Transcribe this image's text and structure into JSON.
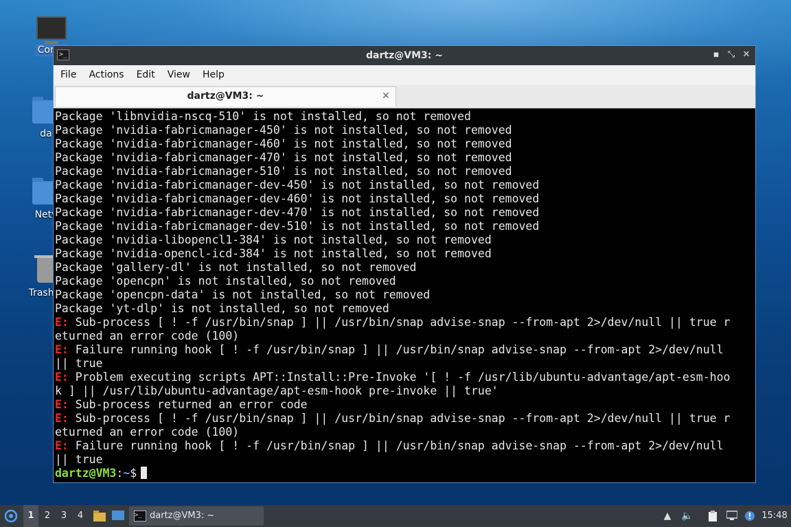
{
  "desktop": {
    "icons": [
      {
        "label": "Comp"
      },
      {
        "label": "da"
      },
      {
        "label": "Netv"
      },
      {
        "label": "Trash (l"
      }
    ]
  },
  "window": {
    "title": "dartz@VM3: ~",
    "controls": {
      "minimize": "▪",
      "maximize": "⤡",
      "close": "✕"
    },
    "menu": [
      "File",
      "Actions",
      "Edit",
      "View",
      "Help"
    ],
    "tab": {
      "label": "dartz@VM3: ~",
      "close": "✕"
    }
  },
  "terminal": {
    "lines": [
      {
        "text": "Package 'libnvidia-nscq-510' is not installed, so not removed"
      },
      {
        "text": "Package 'nvidia-fabricmanager-450' is not installed, so not removed"
      },
      {
        "text": "Package 'nvidia-fabricmanager-460' is not installed, so not removed"
      },
      {
        "text": "Package 'nvidia-fabricmanager-470' is not installed, so not removed"
      },
      {
        "text": "Package 'nvidia-fabricmanager-510' is not installed, so not removed"
      },
      {
        "text": "Package 'nvidia-fabricmanager-dev-450' is not installed, so not removed"
      },
      {
        "text": "Package 'nvidia-fabricmanager-dev-460' is not installed, so not removed"
      },
      {
        "text": "Package 'nvidia-fabricmanager-dev-470' is not installed, so not removed"
      },
      {
        "text": "Package 'nvidia-fabricmanager-dev-510' is not installed, so not removed"
      },
      {
        "text": "Package 'nvidia-libopencl1-384' is not installed, so not removed"
      },
      {
        "text": "Package 'nvidia-opencl-icd-384' is not installed, so not removed"
      },
      {
        "text": "Package 'gallery-dl' is not installed, so not removed"
      },
      {
        "text": "Package 'opencpn' is not installed, so not removed"
      },
      {
        "text": "Package 'opencpn-data' is not installed, so not removed"
      },
      {
        "text": "Package 'yt-dlp' is not installed, so not removed"
      },
      {
        "err": "E:",
        "text": " Sub-process [ ! -f /usr/bin/snap ] || /usr/bin/snap advise-snap --from-apt 2>/dev/null || true r"
      },
      {
        "text": "eturned an error code (100)"
      },
      {
        "err": "E:",
        "text": " Failure running hook [ ! -f /usr/bin/snap ] || /usr/bin/snap advise-snap --from-apt 2>/dev/null"
      },
      {
        "text": "|| true"
      },
      {
        "err": "E:",
        "text": " Problem executing scripts APT::Install::Pre-Invoke '[ ! -f /usr/lib/ubuntu-advantage/apt-esm-hoo"
      },
      {
        "text": "k ] || /usr/lib/ubuntu-advantage/apt-esm-hook pre-invoke || true'"
      },
      {
        "err": "E:",
        "text": " Sub-process returned an error code"
      },
      {
        "err": "E:",
        "text": " Sub-process [ ! -f /usr/bin/snap ] || /usr/bin/snap advise-snap --from-apt 2>/dev/null || true r"
      },
      {
        "text": "eturned an error code (100)"
      },
      {
        "err": "E:",
        "text": " Failure running hook [ ! -f /usr/bin/snap ] || /usr/bin/snap advise-snap --from-apt 2>/dev/null"
      },
      {
        "text": "|| true"
      }
    ],
    "prompt": {
      "user": "dartz@VM3",
      "sep": ":",
      "path": "~",
      "symbol": "$"
    },
    "colors": {
      "error": "#ef2929",
      "prompt_user": "#8ae234",
      "prompt_path": "#729fcf"
    }
  },
  "taskbar": {
    "workspaces": [
      "1",
      "2",
      "3",
      "4"
    ],
    "active_workspace": "1",
    "task": {
      "label": "dartz@VM3: ~"
    },
    "clock": "15:48",
    "tray_icons": [
      "arrow-up-icon",
      "volume-icon",
      "clipboard-icon",
      "network-icon",
      "update-icon"
    ]
  }
}
